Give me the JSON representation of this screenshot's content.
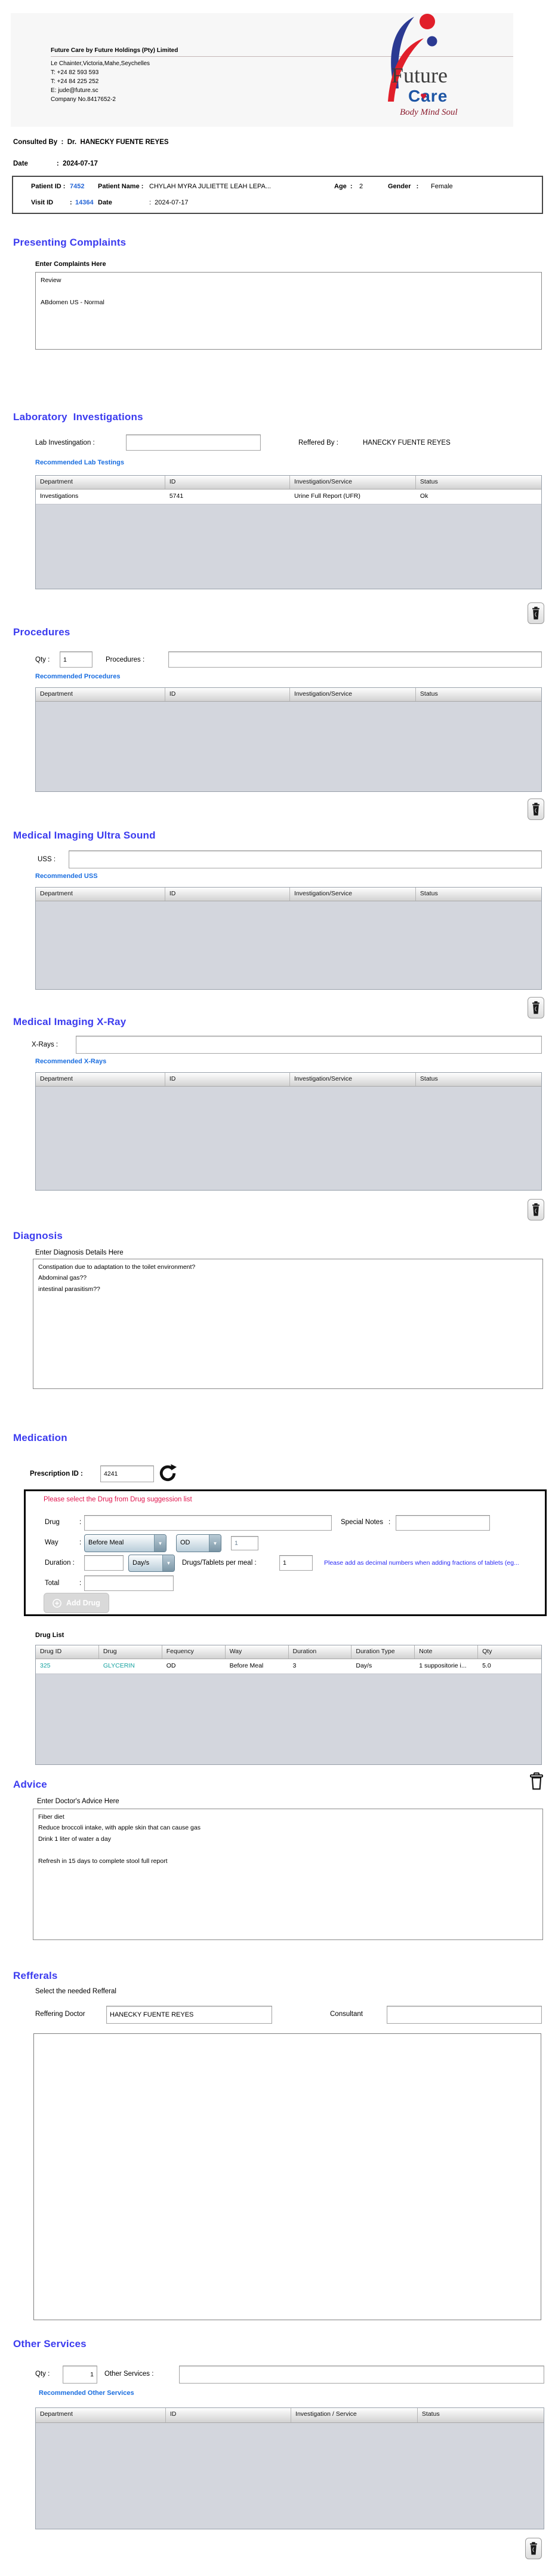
{
  "misc": {
    "colon": ":"
  },
  "icons": {
    "dropdown": "▼"
  },
  "header": {
    "company_title": "Future Care by Future Holdings (Pty) Limited",
    "address": "Le Chainter,Victoria,Mahe,Seychelles",
    "phone1": "T: +24  82 593 593",
    "phone2": "T: +24  84 225 252",
    "email": "E: jude@future.sc",
    "company_no": "Company No.8417652-2",
    "logo": {
      "word1": "Future",
      "word2": "Care",
      "tagline": "Body Mind Soul",
      "heart": "♥"
    }
  },
  "consult": {
    "consulted_line": "Consulted By  :  Dr.  HANECKY FUENTE REYES",
    "date_line": "Date               :  2024-07-17"
  },
  "patient": {
    "patient_id_label": "Patient ID :",
    "patient_id": "7452",
    "patient_name_label": "Patient Name :",
    "patient_name": "CHYLAH MYRA JULIETTE LEAH LEPA...",
    "age_label": "Age  :",
    "age": "2",
    "gender_label": "Gender   :",
    "gender": "Female",
    "visit_id_label": "Visit ID",
    "visit_id": "14364",
    "visit_date_label": "Date",
    "visit_date": ":  2024-07-17"
  },
  "presenting": {
    "title": "Presenting Complaints",
    "label": "Enter Complaints Here",
    "text": "Review\n\nABdomen US - Normal"
  },
  "lab": {
    "title": "Laboratory  Investigations",
    "input_label": "Lab Investingation :",
    "input_value": "",
    "referred_label": "Reffered By :",
    "referred_value": "HANECKY FUENTE REYES",
    "link": "Recommended Lab Testings"
  },
  "procedures": {
    "title": "Procedures",
    "qty_label": "Qty :",
    "qty_value": "1",
    "input_label": "Procedures :",
    "input_value": "",
    "link": "Recommended Procedures"
  },
  "uss": {
    "title": "Medical Imaging Ultra Sound",
    "input_label": "USS :",
    "input_value": "",
    "link": "Recommended USS"
  },
  "xray": {
    "title": "Medical Imaging X-Ray",
    "input_label": "X-Rays :",
    "input_value": "",
    "link": "Recommended X-Rays"
  },
  "diagnosis": {
    "title": "Diagnosis",
    "label": "Enter Diagnosis Details Here",
    "text": "Constipation due to adaptation to the toilet environment?\nAbdominal gas??\nintestinal parasitism??"
  },
  "medication": {
    "title": "Medication",
    "prescription_label": "Prescription ID :",
    "prescription_id": "4241",
    "warning": "Please select the Drug from Drug suggession list",
    "drug_label": "Drug",
    "drug_value": "",
    "special_notes_label": "Special Notes",
    "special_notes_value": "",
    "way_label": "Way",
    "way_value": "Before Meal",
    "freq_value": "OD",
    "freq_extra": "1",
    "duration_label": "Duration :",
    "duration_value": "",
    "duration_unit": "Day/s",
    "per_meal_label": "Drugs/Tablets per meal :",
    "per_meal_value": "1",
    "note": "Please add as decimal numbers when adding fractions of tablets (eg...",
    "total_label": "Total",
    "total_value": "",
    "add_button": "Add Drug",
    "drug_list_label": "Drug List"
  },
  "advice": {
    "title": "Advice",
    "label": "Enter Doctor's Advice Here",
    "text": "Fiber diet\nReduce broccoli intake, with apple skin that can cause gas\nDrink 1 liter of water a day\n\nRefresh in 15 days to complete stool full report"
  },
  "referrals": {
    "title": "Refferals",
    "label": "Select the needed Refferal",
    "doctor_label": "Reffering Doctor",
    "doctor_value": "HANECKY FUENTE REYES",
    "consultant_label": "Consultant",
    "consultant_value": ""
  },
  "other": {
    "title": "Other Services",
    "qty_label": "Qty :",
    "qty_value": "1",
    "input_label": "Other Services :",
    "input_value": "",
    "link": "Recommended Other Services"
  },
  "tables": {
    "standard_headers": [
      "Department",
      "ID",
      "Investigation/Service",
      "Status"
    ],
    "other_headers": [
      "Department",
      "ID",
      "Investigation / Service",
      "Status"
    ],
    "lab_row": [
      "Investigations",
      "5741",
      "Urine Full Report (UFR)",
      "Ok"
    ],
    "drug_headers": [
      "Drug ID",
      "Drug",
      "Fequency",
      "Way",
      "Duration",
      "Duration Type",
      "Note",
      "Qty"
    ],
    "drug_row": [
      "325",
      "GLYCERIN",
      "OD",
      "Before Meal",
      "3",
      "Day/s",
      "1 suppositorie i...",
      "5.0"
    ]
  }
}
